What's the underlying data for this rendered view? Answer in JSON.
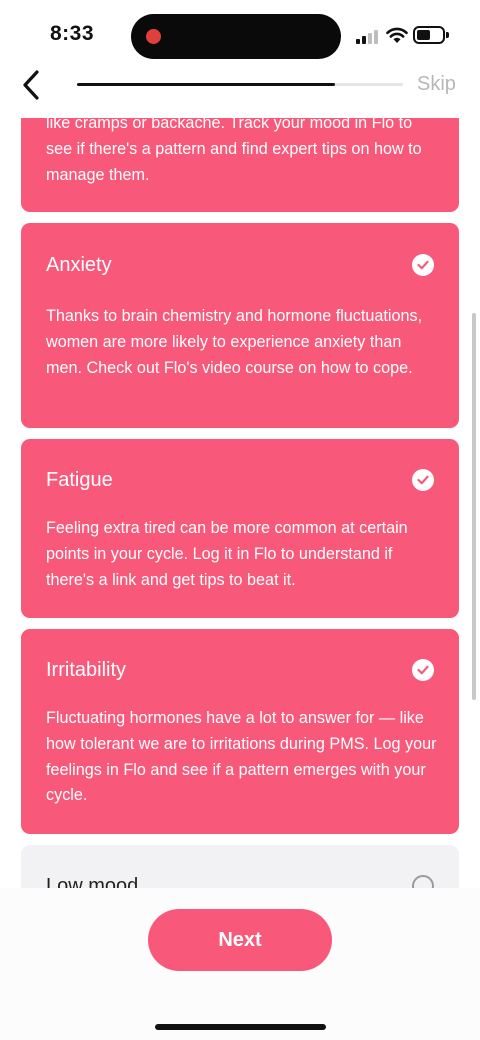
{
  "status": {
    "time": "8:33",
    "signal_bars_on": 2,
    "battery_level": 0.55
  },
  "nav": {
    "back_icon": "chevron-left-icon",
    "progress_fraction": 0.79,
    "skip_label": "Skip"
  },
  "cards": [
    {
      "title": "",
      "body": "like cramps or backache. Track your mood in Flo to see if there's a pattern and find expert tips on how to manage them.",
      "selected": true
    },
    {
      "title": "Anxiety",
      "body": "Thanks to brain chemistry and hormone fluctuations, women are more likely to experience anxiety than men. Check out Flo's video course on how to cope.",
      "selected": true
    },
    {
      "title": "Fatigue",
      "body": "Feeling extra tired can be more common at certain points in your cycle. Log it in Flo to understand if there's a link and get tips to beat it.",
      "selected": true
    },
    {
      "title": "Irritability",
      "body": "Fluctuating hormones have a lot to answer for — like how tolerant we are to irritations during PMS. Log your feelings in Flo and see if a pattern emerges with your cycle.",
      "selected": true
    },
    {
      "title": "Low mood",
      "body": "",
      "selected": false
    }
  ],
  "footer": {
    "next_label": "Next"
  },
  "colors": {
    "accent": "#f8597a",
    "unselected_card": "#f2f2f4",
    "text_dark": "#111111"
  }
}
